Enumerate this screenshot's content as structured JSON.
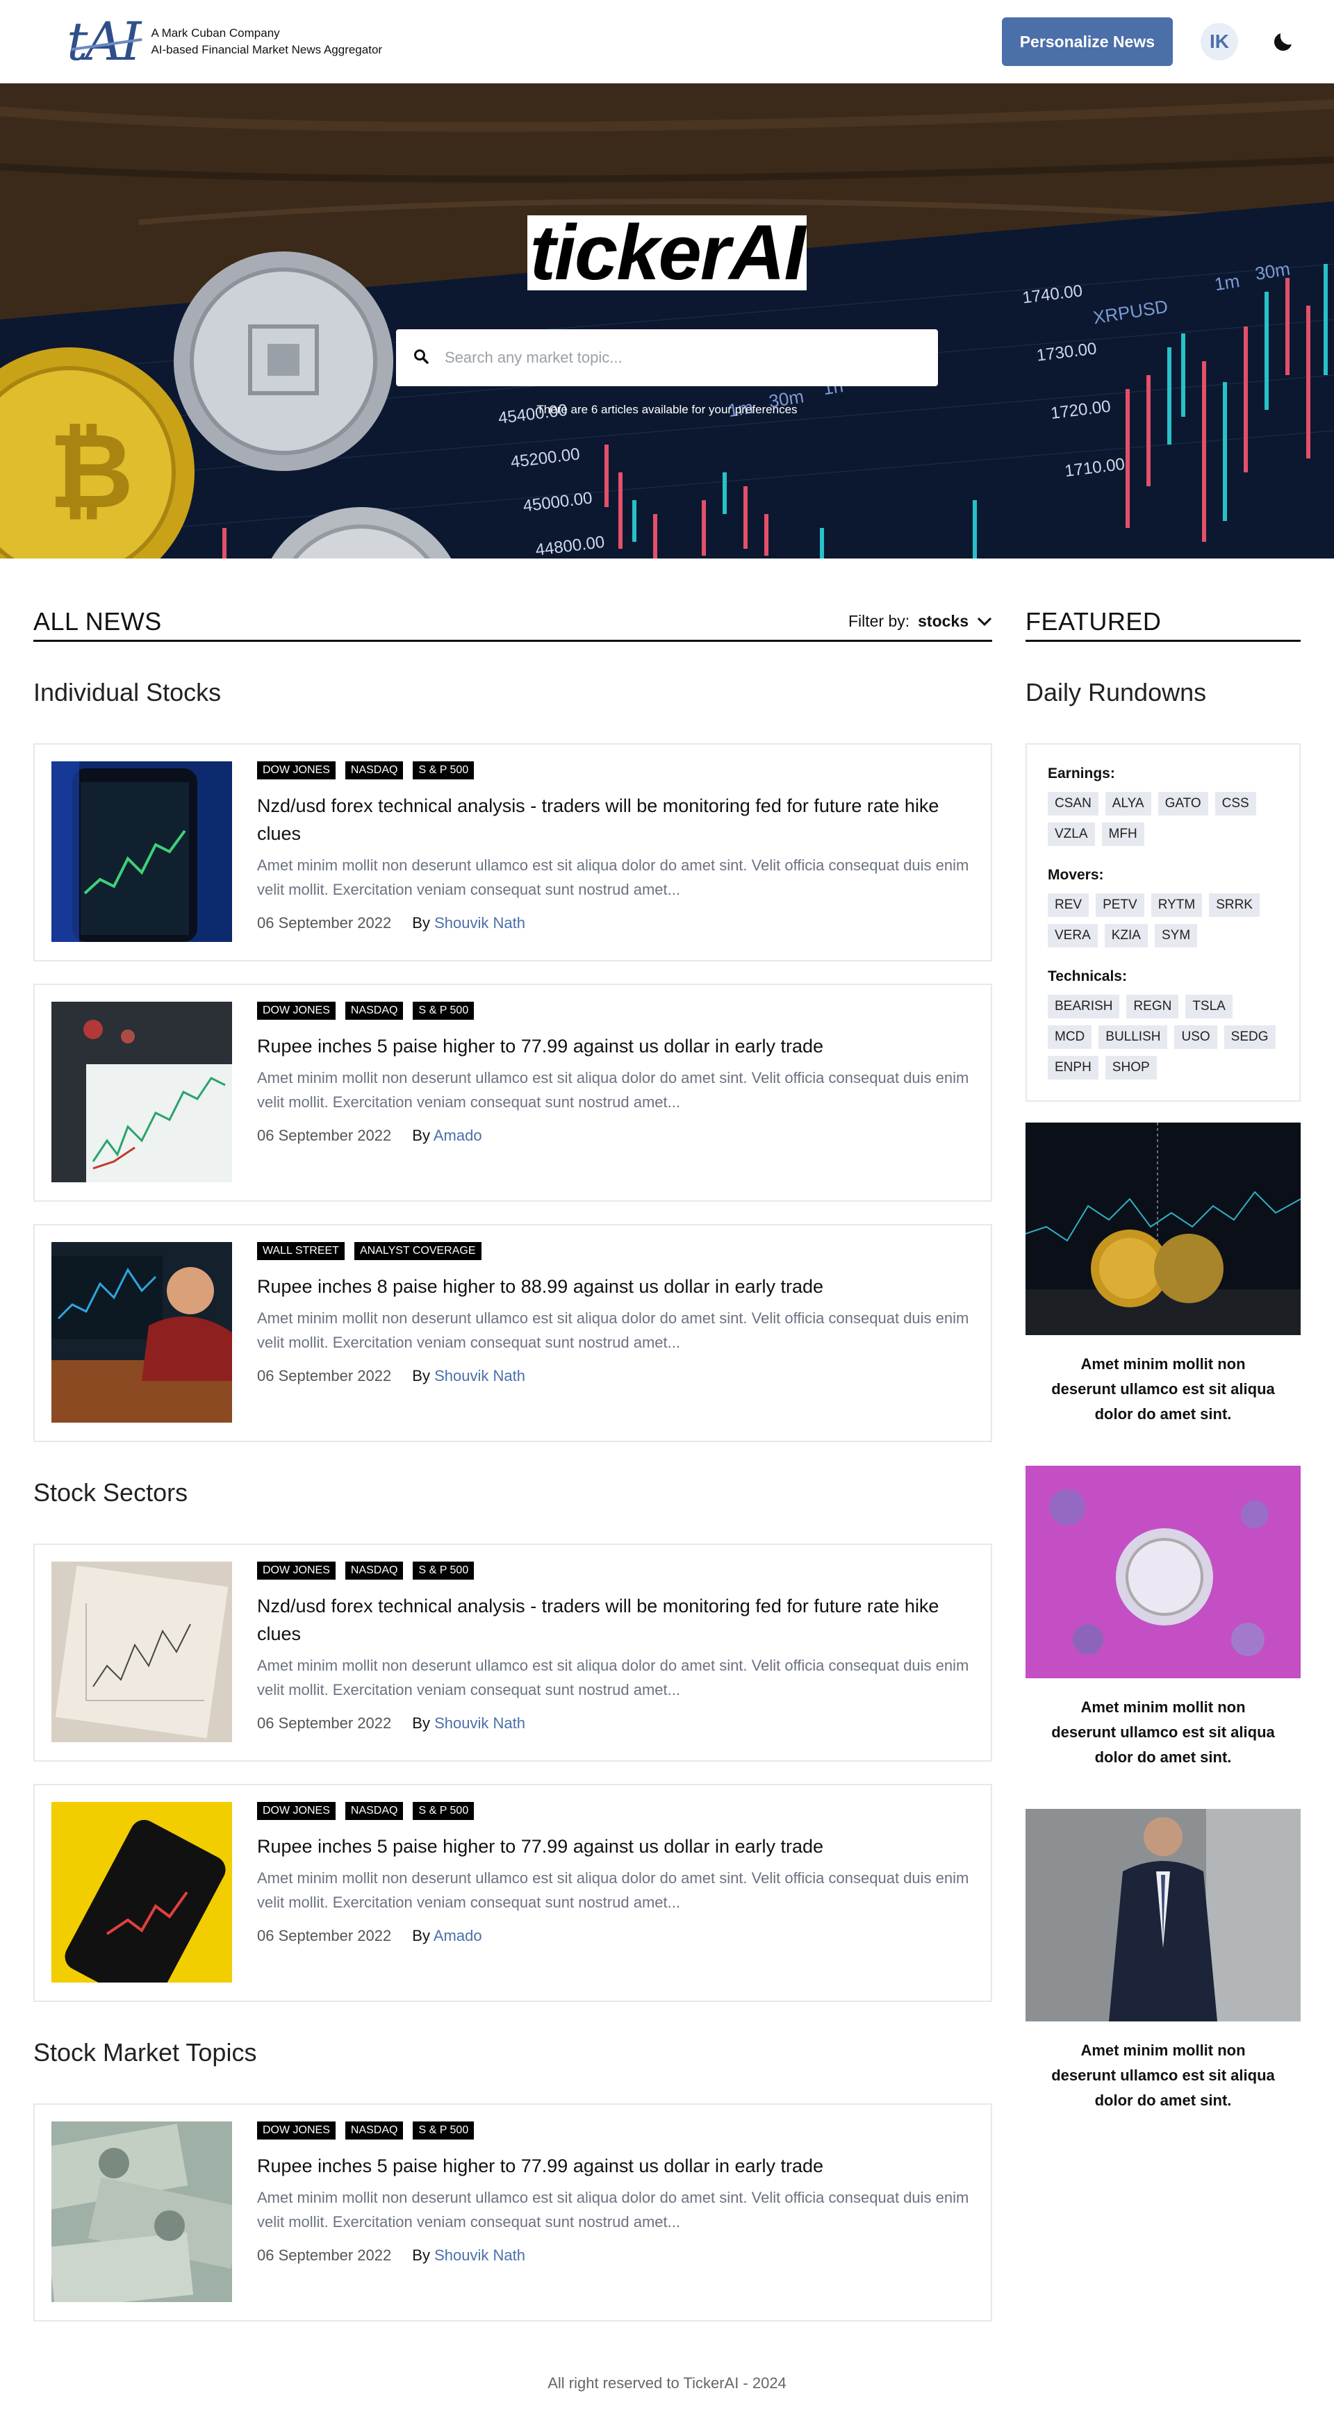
{
  "header": {
    "logo_text": "tAI",
    "tagline_1": "A Mark Cuban Company",
    "tagline_2": "AI-based Financial Market News Aggregator",
    "personalize_label": "Personalize News",
    "avatar_initials": "IK"
  },
  "hero": {
    "title": "tickerAI",
    "search_placeholder": "Search any market topic...",
    "note": "There are 6 articles available for your preferences",
    "chart_price_labels": [
      "45400.00",
      "45200.00",
      "45000.00",
      "44800.00",
      "1740.00",
      "1730.00",
      "1720.00",
      "1710.00"
    ],
    "chart_toolbar": [
      "1m",
      "30m",
      "1h",
      "XRPUSD",
      "1m",
      "30m"
    ]
  },
  "news": {
    "heading": "ALL NEWS",
    "filter_label": "Filter by:",
    "filter_value": "stocks",
    "groups": [
      {
        "title": "Individual Stocks",
        "articles": [
          {
            "tags": [
              "DOW JONES",
              "NASDAQ",
              "S & P 500"
            ],
            "title": "Nzd/usd forex technical analysis - traders will be monitoring fed for future rate hike clues",
            "excerpt": "Amet minim mollit non deserunt ullamco est sit aliqua dolor do amet sint. Velit officia consequat duis enim velit mollit. Exercitation veniam consequat sunt nostrud amet...",
            "date": "06 September 2022",
            "by": "By",
            "author": "Shouvik Nath"
          },
          {
            "tags": [
              "DOW JONES",
              "NASDAQ",
              "S & P 500"
            ],
            "title": "Rupee inches 5 paise higher to 77.99 against us dollar in early trade",
            "excerpt": "Amet minim mollit non deserunt ullamco est sit aliqua dolor do amet sint. Velit officia consequat duis enim velit mollit. Exercitation veniam consequat sunt nostrud amet...",
            "date": "06 September 2022",
            "by": "By",
            "author": "Amado"
          },
          {
            "tags": [
              "WALL STREET",
              "ANALYST COVERAGE"
            ],
            "title": "Rupee inches 8 paise higher to 88.99 against us dollar in early trade",
            "excerpt": "Amet minim mollit non deserunt ullamco est sit aliqua dolor do amet sint. Velit officia consequat duis enim velit mollit. Exercitation veniam consequat sunt nostrud amet...",
            "date": "06 September 2022",
            "by": "By",
            "author": "Shouvik Nath"
          }
        ]
      },
      {
        "title": "Stock Sectors",
        "articles": [
          {
            "tags": [
              "DOW JONES",
              "NASDAQ",
              "S & P 500"
            ],
            "title": "Nzd/usd forex technical analysis - traders will be monitoring fed for future rate hike clues",
            "excerpt": "Amet minim mollit non deserunt ullamco est sit aliqua dolor do amet sint. Velit officia consequat duis enim velit mollit. Exercitation veniam consequat sunt nostrud amet...",
            "date": "06 September 2022",
            "by": "By",
            "author": "Shouvik Nath"
          },
          {
            "tags": [
              "DOW JONES",
              "NASDAQ",
              "S & P 500"
            ],
            "title": "Rupee inches 5 paise higher to 77.99 against us dollar in early trade",
            "excerpt": "Amet minim mollit non deserunt ullamco est sit aliqua dolor do amet sint. Velit officia consequat duis enim velit mollit. Exercitation veniam consequat sunt nostrud amet...",
            "date": "06 September 2022",
            "by": "By",
            "author": "Amado"
          }
        ]
      },
      {
        "title": "Stock Market Topics",
        "articles": [
          {
            "tags": [
              "DOW JONES",
              "NASDAQ",
              "S & P 500"
            ],
            "title": "Rupee inches 5 paise higher to 77.99 against us dollar in early trade",
            "excerpt": "Amet minim mollit non deserunt ullamco est sit aliqua dolor do amet sint. Velit officia consequat duis enim velit mollit. Exercitation veniam consequat sunt nostrud amet...",
            "date": "06 September 2022",
            "by": "By",
            "author": "Shouvik Nath"
          }
        ]
      }
    ]
  },
  "featured": {
    "heading": "FEATURED",
    "rundowns_title": "Daily Rundowns",
    "earnings_label": "Earnings:",
    "earnings": [
      "CSAN",
      "ALYA",
      "GATO",
      "CSS",
      "VZLA",
      "MFH"
    ],
    "movers_label": "Movers:",
    "movers": [
      "REV",
      "PETV",
      "RYTM",
      "SRRK",
      "VERA",
      "KZIA",
      "SYM"
    ],
    "technicals_label": "Technicals:",
    "technicals": [
      "BEARISH",
      "REGN",
      "TSLA",
      "MCD",
      "BULLISH",
      "USO",
      "SEDG",
      "ENPH",
      "SHOP"
    ],
    "captions": [
      "Amet minim mollit non deserunt ullamco est sit aliqua dolor do amet sint.",
      "Amet minim mollit non deserunt ullamco est sit aliqua dolor do amet sint.",
      "Amet minim mollit non deserunt ullamco est sit aliqua dolor do amet sint."
    ]
  },
  "footer": {
    "text": "All right reserved to TickerAI - 2024"
  },
  "colors": {
    "accent": "#4b6fa8",
    "tag_bg": "#000000",
    "chip_bg": "#e6e9ef"
  }
}
